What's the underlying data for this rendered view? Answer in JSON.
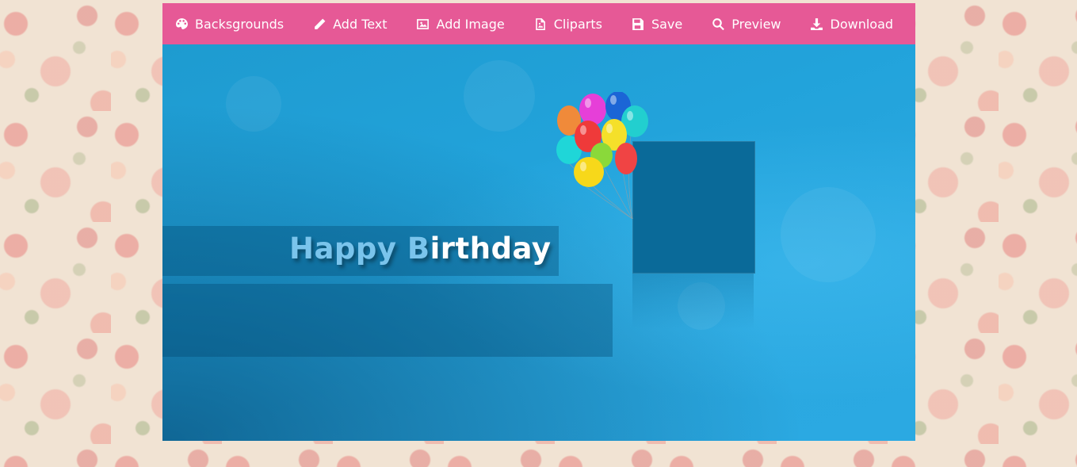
{
  "toolbar": {
    "items": [
      {
        "label": "Backsgrounds",
        "icon": "palette-icon"
      },
      {
        "label": "Add Text",
        "icon": "pencil-icon"
      },
      {
        "label": "Add Image",
        "icon": "image-icon"
      },
      {
        "label": "Cliparts",
        "icon": "file-image-icon"
      },
      {
        "label": "Save",
        "icon": "floppy-icon"
      },
      {
        "label": "Preview",
        "icon": "search-icon"
      },
      {
        "label": "Download",
        "icon": "download-icon"
      }
    ]
  },
  "card": {
    "headline_light": "Happy B",
    "headline_white": "irthday"
  },
  "colors": {
    "toolbar_bg": "#e65996",
    "canvas_blue": "#22a3db",
    "headline_light": "#7ac4ec",
    "headline_white": "#ffffff"
  }
}
